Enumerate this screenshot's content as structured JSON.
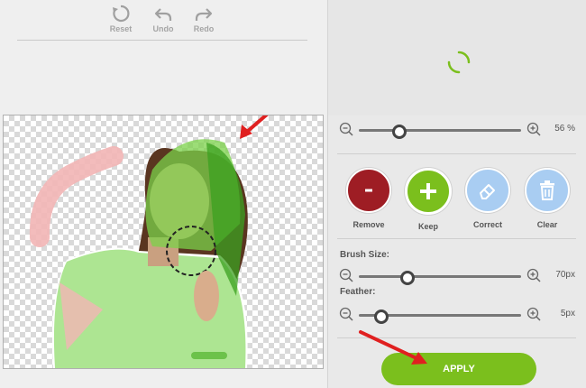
{
  "toolbar": {
    "reset_label": "Reset",
    "undo_label": "Undo",
    "redo_label": "Redo"
  },
  "icons": {
    "reset": "reset-icon",
    "undo": "undo-icon",
    "redo": "redo-icon",
    "zoom_out": "zoom-out-icon",
    "zoom_in": "zoom-in-icon",
    "remove": "minus-icon",
    "keep": "plus-icon",
    "correct": "eraser-icon",
    "clear": "trash-icon"
  },
  "preview": {
    "loading": true
  },
  "zoom": {
    "value_label": "56 %",
    "level": 0.25
  },
  "tools": [
    {
      "label": "Remove",
      "color": "#9e1d24"
    },
    {
      "label": "Keep",
      "color": "#7bbf1d"
    },
    {
      "label": "Correct",
      "color": "#a9cdf2"
    },
    {
      "label": "Clear",
      "color": "#a9cdf2"
    }
  ],
  "brush": {
    "label": "Brush Size:",
    "value_label": "70px",
    "level": 0.3
  },
  "feather": {
    "label": "Feather:",
    "value_label": "5px",
    "level": 0.14
  },
  "apply_label": "APPLY",
  "colors": {
    "accent_green": "#7bbf1d",
    "remove_red": "#9e1d24",
    "annotation_red": "#e02020"
  }
}
